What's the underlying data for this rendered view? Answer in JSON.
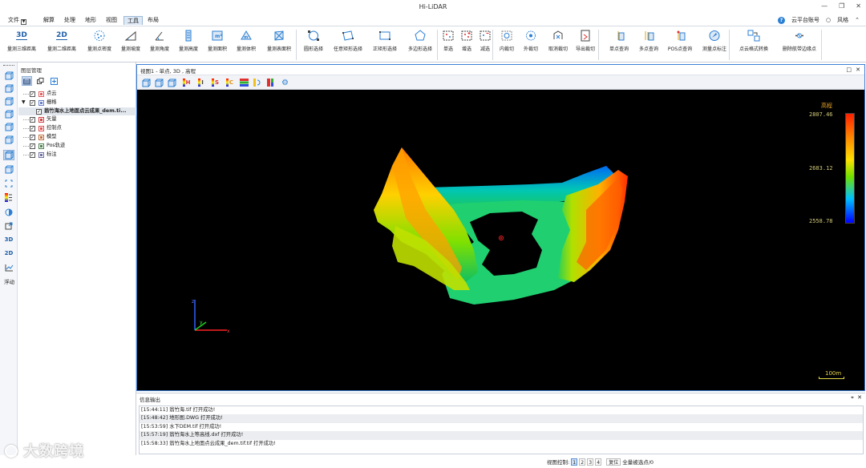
{
  "app": {
    "title": "Hi-LiDAR"
  },
  "menubar": {
    "file_label": "文件",
    "items": [
      "解算",
      "处理",
      "地形",
      "视图",
      "工具",
      "布局"
    ],
    "active": "工具",
    "account_label": "云平台账号",
    "style_label": "风格"
  },
  "ribbon": {
    "buttons": [
      {
        "label": "量测三维距离",
        "icon": "3d-text-icon",
        "text": "3D"
      },
      {
        "label": "量测二维距离",
        "icon": "2d-text-icon",
        "text": "2D"
      },
      {
        "label": "量测点密度",
        "icon": "point-density-icon",
        "text": ""
      },
      {
        "label": "量测坡度",
        "icon": "slope-icon",
        "text": ""
      },
      {
        "label": "量测角度",
        "icon": "angle-icon",
        "text": ""
      },
      {
        "label": "量测高度",
        "icon": "height-icon",
        "text": ""
      },
      {
        "label": "量测面积",
        "icon": "area-icon",
        "text": ""
      },
      {
        "label": "量测体积",
        "icon": "volume-icon",
        "text": ""
      },
      {
        "label": "量测表面积",
        "icon": "surface-area-icon",
        "text": ""
      },
      {
        "label": "圆形选择",
        "icon": "circle-select-icon",
        "text": ""
      },
      {
        "label": "任意矩形选择",
        "icon": "free-rect-select-icon",
        "text": ""
      },
      {
        "label": "正矩形选择",
        "icon": "rect-select-icon",
        "text": ""
      },
      {
        "label": "多边形选择",
        "icon": "polygon-select-icon",
        "text": ""
      },
      {
        "label": "单选",
        "icon": "single-select-icon",
        "text": ""
      },
      {
        "label": "增选",
        "icon": "add-select-icon",
        "text": ""
      },
      {
        "label": "减选",
        "icon": "subtract-select-icon",
        "text": ""
      },
      {
        "label": "内裁切",
        "icon": "inner-clip-icon",
        "text": ""
      },
      {
        "label": "外裁切",
        "icon": "outer-clip-icon",
        "text": ""
      },
      {
        "label": "取消裁切",
        "icon": "cancel-clip-icon",
        "text": ""
      },
      {
        "label": "导出裁切",
        "icon": "export-clip-icon",
        "text": ""
      },
      {
        "label": "单点查询",
        "icon": "single-point-query-icon",
        "text": ""
      },
      {
        "label": "多点查询",
        "icon": "multi-point-query-icon",
        "text": ""
      },
      {
        "label": "POS点查询",
        "icon": "pos-point-query-icon",
        "text": ""
      },
      {
        "label": "测量点标注",
        "icon": "measure-point-label-icon",
        "text": ""
      },
      {
        "label": "点云格式转换",
        "icon": "format-convert-icon",
        "text": ""
      },
      {
        "label": "删除航带边缘点",
        "icon": "delete-edge-points-icon",
        "text": ""
      }
    ]
  },
  "left_toolbar": {
    "float_label": "浮动"
  },
  "layer_panel": {
    "title": "图层管理",
    "items": [
      {
        "label": "点云",
        "indent": 1,
        "checked": true,
        "icon": "point-cloud-layer-icon",
        "expand": false,
        "bold": false
      },
      {
        "label": "栅格",
        "indent": 1,
        "checked": true,
        "icon": "raster-layer-icon",
        "expand": true,
        "bold": false
      },
      {
        "label": "翁竹海水上地面点云成果_dem.ti...",
        "indent": 2,
        "checked": true,
        "icon": "",
        "expand": false,
        "bold": true
      },
      {
        "label": "矢量",
        "indent": 1,
        "checked": true,
        "icon": "vector-layer-icon",
        "expand": false,
        "bold": false
      },
      {
        "label": "控制点",
        "indent": 1,
        "checked": true,
        "icon": "control-point-layer-icon",
        "expand": false,
        "bold": false
      },
      {
        "label": "模型",
        "indent": 1,
        "checked": true,
        "icon": "model-layer-icon",
        "expand": false,
        "bold": false
      },
      {
        "label": "Pos轨迹",
        "indent": 1,
        "checked": true,
        "icon": "pos-track-layer-icon",
        "expand": false,
        "bold": false
      },
      {
        "label": "标注",
        "indent": 1,
        "checked": true,
        "icon": "annotation-layer-icon",
        "expand": false,
        "bold": false
      }
    ]
  },
  "view": {
    "title": "视图1 - 单点, 3D , 高程",
    "legend_title": "高程",
    "legend_values": [
      "2807.46",
      "2683.12",
      "2558.78"
    ],
    "scale_label": "100m",
    "colors": {
      "legend_text": "#d0c878",
      "legend_title": "#e8a428",
      "scale": "#e8d44a"
    }
  },
  "info": {
    "title": "信息输出",
    "logs": [
      "[15:44:11] 翁竹海.tif 打开成功!",
      "[15:48:42] 地形图.DWG 打开成功!",
      "[15:53:59] 水下DEM.tif 打开成功!",
      "[15:57:19] 翁竹海水上等高线.dxf 打开成功!",
      "[15:58:33] 翁竹海水上地面点云成果_dem.tif.tif 打开成功!"
    ]
  },
  "status": {
    "view_control_label": "视图控制:",
    "pages": [
      "1",
      "2",
      "3",
      "4"
    ],
    "active_page": "1",
    "reset_label": "复位",
    "selected_points_label": "全量被选点/0"
  },
  "watermark": {
    "text": "大数跨境"
  }
}
